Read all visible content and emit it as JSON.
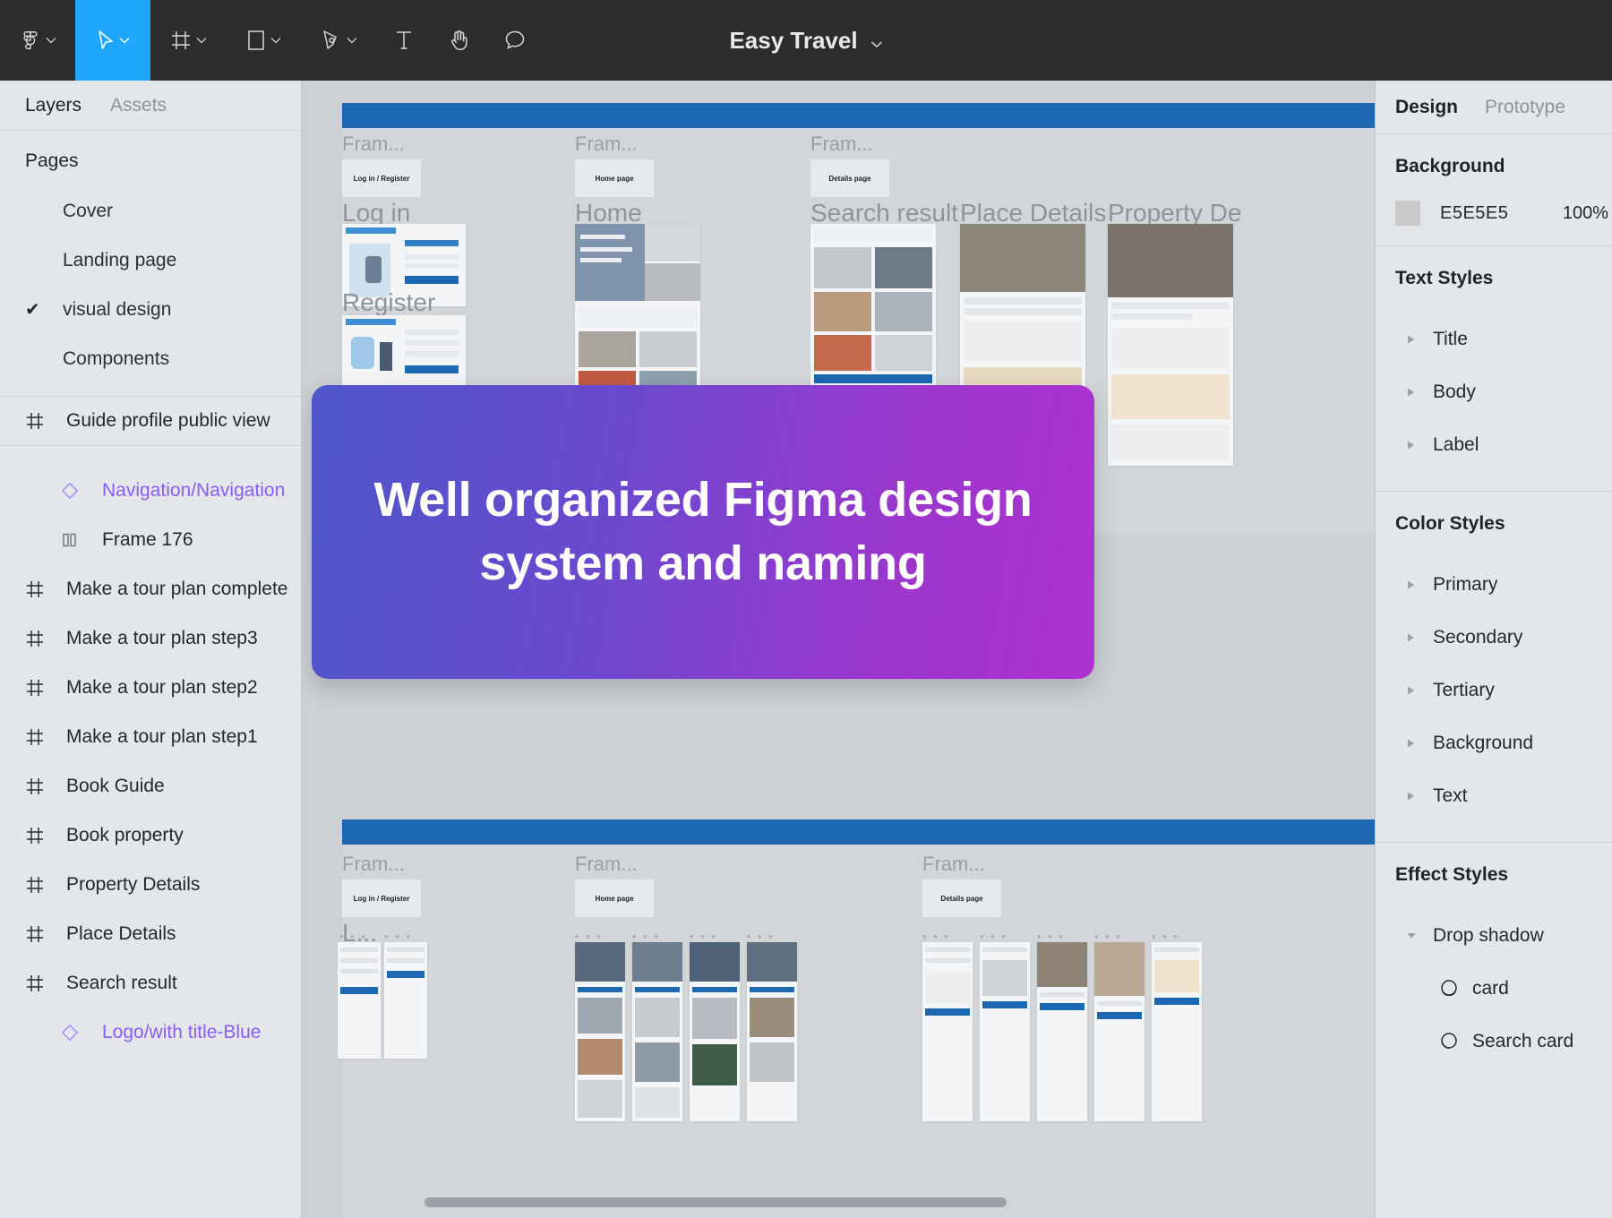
{
  "toolbar": {
    "tools": [
      {
        "name": "figma-logo-icon",
        "label": "Figma menu",
        "caret": true,
        "active": false
      },
      {
        "name": "move-cursor-icon",
        "label": "Move",
        "caret": true,
        "active": true
      },
      {
        "name": "frame-icon",
        "label": "Frame",
        "caret": true,
        "active": false
      },
      {
        "name": "shape-rectangle-icon",
        "label": "Shape",
        "caret": true,
        "active": false
      },
      {
        "name": "pen-icon",
        "label": "Pen",
        "caret": true,
        "active": false
      },
      {
        "name": "text-icon",
        "label": "Text",
        "caret": false,
        "active": false
      },
      {
        "name": "hand-icon",
        "label": "Hand",
        "caret": false,
        "active": false
      },
      {
        "name": "comment-icon",
        "label": "Comment",
        "caret": false,
        "active": false
      }
    ],
    "file_title": "Easy Travel"
  },
  "left_panel": {
    "tabs": [
      {
        "label": "Layers",
        "active": true
      },
      {
        "label": "Assets",
        "active": false
      }
    ],
    "pages_heading": "Pages",
    "pages": [
      {
        "label": "Cover",
        "selected": false
      },
      {
        "label": "Landing page",
        "selected": false
      },
      {
        "label": "visual design",
        "selected": true
      },
      {
        "label": "Components",
        "selected": false
      }
    ],
    "selected_check": "✔",
    "layers": [
      {
        "label": "Guide profile public view",
        "icon": "frame-hash-icon",
        "type": "frame",
        "indent": false
      },
      {
        "label": "Navigation/Navigation",
        "icon": "component-diamond-icon",
        "type": "component",
        "indent": true
      },
      {
        "label": "Frame 176",
        "icon": "group-icon",
        "type": "group",
        "indent": true
      },
      {
        "label": "Make a tour plan complete",
        "icon": "frame-hash-icon",
        "type": "frame",
        "indent": false
      },
      {
        "label": "Make a tour plan step3",
        "icon": "frame-hash-icon",
        "type": "frame",
        "indent": false
      },
      {
        "label": "Make a tour plan step2",
        "icon": "frame-hash-icon",
        "type": "frame",
        "indent": false
      },
      {
        "label": "Make a tour plan step1",
        "icon": "frame-hash-icon",
        "type": "frame",
        "indent": false
      },
      {
        "label": "Book Guide",
        "icon": "frame-hash-icon",
        "type": "frame",
        "indent": false
      },
      {
        "label": "Book property",
        "icon": "frame-hash-icon",
        "type": "frame",
        "indent": false
      },
      {
        "label": "Property Details",
        "icon": "frame-hash-icon",
        "type": "frame",
        "indent": false
      },
      {
        "label": "Place Details",
        "icon": "frame-hash-icon",
        "type": "frame",
        "indent": false
      },
      {
        "label": "Search result",
        "icon": "frame-hash-icon",
        "type": "frame",
        "indent": false
      },
      {
        "label": "Logo/with title-Blue",
        "icon": "component-diamond-icon",
        "type": "component",
        "indent": true
      }
    ]
  },
  "canvas": {
    "frame_labels": [
      "Fram...",
      "Fram...",
      "Fram...",
      "Fram...",
      "Fram...",
      "Fram..."
    ],
    "mini_cards": [
      "Log in / Register",
      "Home page",
      "Details page",
      "Log in / Register",
      "Home page",
      "Details page"
    ],
    "section_labels": [
      "Log in",
      "Home",
      "Search result",
      "Place Details",
      "Property De",
      "Register",
      "L..."
    ],
    "dots": "• • •"
  },
  "promo": {
    "text": "Well organized Figma design system and naming",
    "gradient_from": "#4E57C9",
    "gradient_to": "#AE31CF"
  },
  "right_panel": {
    "tabs": [
      {
        "label": "Design",
        "active": true
      },
      {
        "label": "Prototype",
        "active": false
      }
    ],
    "background": {
      "heading": "Background",
      "hex": "E5E5E5",
      "opacity": "100%",
      "swatch": "#C9C9C9"
    },
    "text_styles": {
      "heading": "Text Styles",
      "items": [
        {
          "label": "Title",
          "expanded": false
        },
        {
          "label": "Body",
          "expanded": false
        },
        {
          "label": "Label",
          "expanded": false
        }
      ]
    },
    "color_styles": {
      "heading": "Color Styles",
      "items": [
        {
          "label": "Primary",
          "expanded": false
        },
        {
          "label": "Secondary",
          "expanded": false
        },
        {
          "label": "Tertiary",
          "expanded": false
        },
        {
          "label": "Background",
          "expanded": false
        },
        {
          "label": "Text",
          "expanded": false
        }
      ]
    },
    "effect_styles": {
      "heading": "Effect Styles",
      "groups": [
        {
          "label": "Drop shadow",
          "expanded": true,
          "items": [
            {
              "label": "card",
              "icon": "drop-shadow-circle-icon"
            },
            {
              "label": "Search card",
              "icon": "drop-shadow-circle-icon"
            }
          ]
        }
      ]
    }
  }
}
